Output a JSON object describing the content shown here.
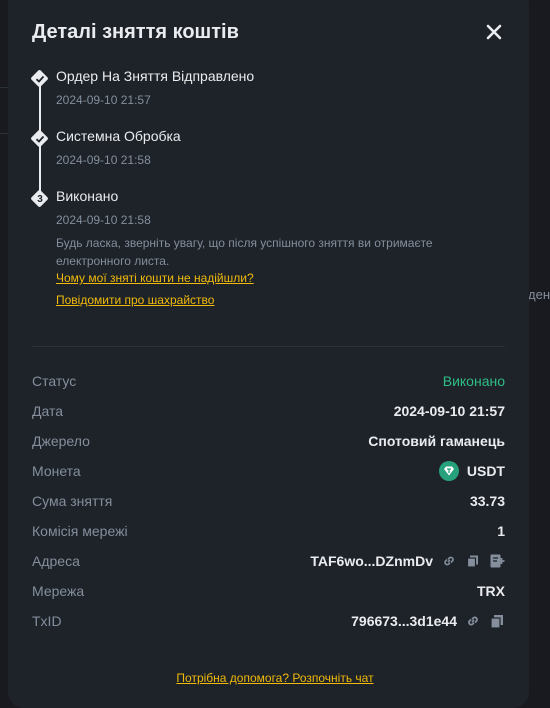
{
  "background": {
    "peek_text": "ден"
  },
  "modal": {
    "title": "Деталі зняття коштів",
    "close_icon": "close-icon"
  },
  "timeline": {
    "steps": [
      {
        "title": "Ордер На Зняття Відправлено",
        "time": "2024-09-10 21:57",
        "state": "done"
      },
      {
        "title": "Системна Обробка",
        "time": "2024-09-10 21:58",
        "state": "done"
      },
      {
        "title": "Виконано",
        "time": "2024-09-10 21:58",
        "number": "3"
      }
    ],
    "note": "Будь ласка, зверніть увагу, що після успішного зняття ви отримаєте електронного листа.",
    "link_not_received": "Чому мої зняті кошти не надійшли?",
    "link_report_fraud": "Повідомити про шахрайство"
  },
  "details": {
    "status": {
      "label": "Статус",
      "value": "Виконано"
    },
    "date": {
      "label": "Дата",
      "value": "2024-09-10 21:57"
    },
    "source": {
      "label": "Джерело",
      "value": "Спотовий гаманець"
    },
    "coin": {
      "label": "Монета",
      "value": "USDT"
    },
    "amount": {
      "label": "Сума зняття",
      "value": "33.73"
    },
    "fee": {
      "label": "Комісія мережі",
      "value": "1"
    },
    "address": {
      "label": "Адреса",
      "value": "TAF6wo...DZnmDv"
    },
    "network": {
      "label": "Мережа",
      "value": "TRX"
    },
    "txid": {
      "label": "TxID",
      "value": "796673...3d1e44"
    }
  },
  "footer": {
    "help_link": "Потрібна допомога? Розпочніть чат"
  },
  "colors": {
    "accent": "#f0b90b",
    "success": "#2ebd85",
    "muted": "#848e9c",
    "usdt": "#26a17b"
  }
}
